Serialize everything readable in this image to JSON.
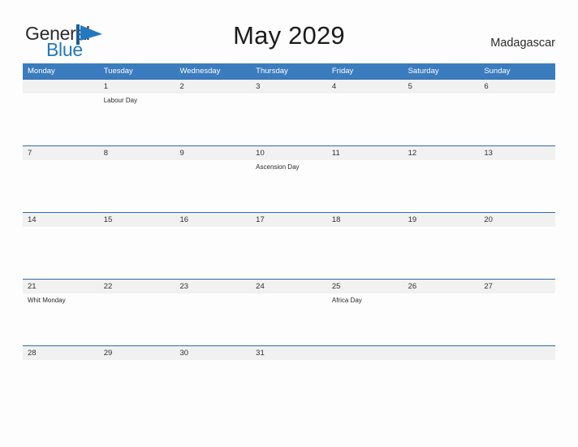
{
  "brand": {
    "name_top": "General",
    "name_bottom": "Blue",
    "flag_color": "#2279bd"
  },
  "header": {
    "title": "May 2029",
    "country": "Madagascar"
  },
  "theme": {
    "header_blue": "#3a7cbe",
    "row_divider": "#2f6ca8",
    "date_band_gray": "#f1f1f1",
    "page_background": "#fdfdfd"
  },
  "calendar": {
    "weekdays": [
      "Monday",
      "Tuesday",
      "Wednesday",
      "Thursday",
      "Friday",
      "Saturday",
      "Sunday"
    ],
    "weeks": [
      {
        "days": [
          {
            "date": "",
            "event": ""
          },
          {
            "date": "1",
            "event": "Labour Day"
          },
          {
            "date": "2",
            "event": ""
          },
          {
            "date": "3",
            "event": ""
          },
          {
            "date": "4",
            "event": ""
          },
          {
            "date": "5",
            "event": ""
          },
          {
            "date": "6",
            "event": ""
          }
        ]
      },
      {
        "days": [
          {
            "date": "7",
            "event": ""
          },
          {
            "date": "8",
            "event": ""
          },
          {
            "date": "9",
            "event": ""
          },
          {
            "date": "10",
            "event": "Ascension Day"
          },
          {
            "date": "11",
            "event": ""
          },
          {
            "date": "12",
            "event": ""
          },
          {
            "date": "13",
            "event": ""
          }
        ]
      },
      {
        "days": [
          {
            "date": "14",
            "event": ""
          },
          {
            "date": "15",
            "event": ""
          },
          {
            "date": "16",
            "event": ""
          },
          {
            "date": "17",
            "event": ""
          },
          {
            "date": "18",
            "event": ""
          },
          {
            "date": "19",
            "event": ""
          },
          {
            "date": "20",
            "event": ""
          }
        ]
      },
      {
        "days": [
          {
            "date": "21",
            "event": "Whit Monday"
          },
          {
            "date": "22",
            "event": ""
          },
          {
            "date": "23",
            "event": ""
          },
          {
            "date": "24",
            "event": ""
          },
          {
            "date": "25",
            "event": "Africa Day"
          },
          {
            "date": "26",
            "event": ""
          },
          {
            "date": "27",
            "event": ""
          }
        ]
      },
      {
        "days": [
          {
            "date": "28",
            "event": ""
          },
          {
            "date": "29",
            "event": ""
          },
          {
            "date": "30",
            "event": ""
          },
          {
            "date": "31",
            "event": ""
          },
          {
            "date": "",
            "event": ""
          },
          {
            "date": "",
            "event": ""
          },
          {
            "date": "",
            "event": ""
          }
        ]
      }
    ]
  }
}
